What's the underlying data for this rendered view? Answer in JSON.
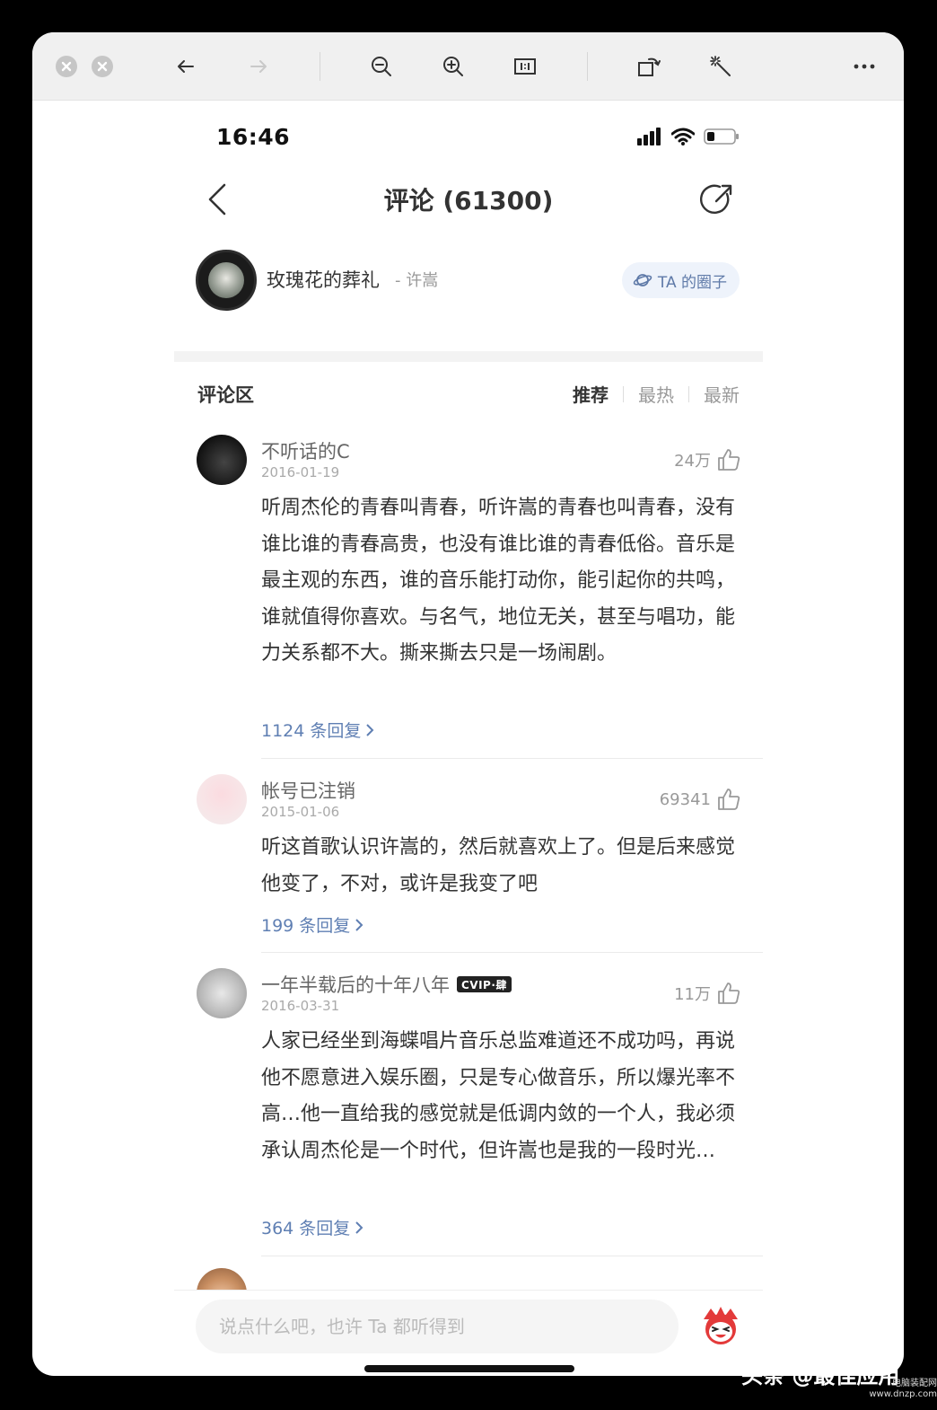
{
  "status": {
    "time": "16:46"
  },
  "nav": {
    "title": "评论 (61300)"
  },
  "song": {
    "title": "玫瑰花的葬礼",
    "artist": "- 许嵩",
    "circle_label": "TA 的圈子"
  },
  "section": {
    "title": "评论区",
    "tabs": [
      "推荐",
      "最热",
      "最新"
    ],
    "active_tab": "推荐"
  },
  "comments": [
    {
      "user": "不听话的C",
      "date": "2016-01-19",
      "likes": "24万",
      "text": "听周杰伦的青春叫青春，听许嵩的青春也叫青春，没有谁比谁的青春高贵，也没有谁比谁的青春低俗。音乐是最主观的东西，谁的音乐能打动你，能引起你的共鸣，谁就值得你喜欢。与名气，地位无关，甚至与唱功，能力关系都不大。撕来撕去只是一场闹剧。",
      "replies": "1124 条回复"
    },
    {
      "user": "帐号已注销",
      "date": "2015-01-06",
      "likes": "69341",
      "text": "听这首歌认识许嵩的，然后就喜欢上了。但是后来感觉他变了，不对，或许是我变了吧",
      "replies": "199 条回复"
    },
    {
      "user": "一年半载后的十年八年",
      "badge": "CVIP·肆",
      "date": "2016-03-31",
      "likes": "11万",
      "text": "人家已经坐到海蝶唱片音乐总监难道还不成功吗，再说他不愿意进入娱乐圈，只是专心做音乐，所以爆光率不高…他一直给我的感觉就是低调内敛的一个人，我必须承认周杰伦是一个时代，但许嵩也是我的一段时光…",
      "replies": "364 条回复"
    }
  ],
  "input": {
    "placeholder": "说点什么吧，也许 Ta 都听得到"
  },
  "watermark": {
    "main": "头条 @最佳应用",
    "small": "电脑装配网 www.dnzp.com"
  },
  "icons": [
    "close-icon",
    "minimize-icon",
    "back-arrow-icon",
    "forward-arrow-icon",
    "zoom-out-icon",
    "zoom-in-icon",
    "actual-size-icon",
    "rotate-icon",
    "magic-wand-icon",
    "more-icon",
    "signal-icon",
    "wifi-icon",
    "battery-icon",
    "share-icon",
    "thumb-up-icon",
    "chevron-right-icon",
    "planet-icon",
    "mascot-icon"
  ]
}
